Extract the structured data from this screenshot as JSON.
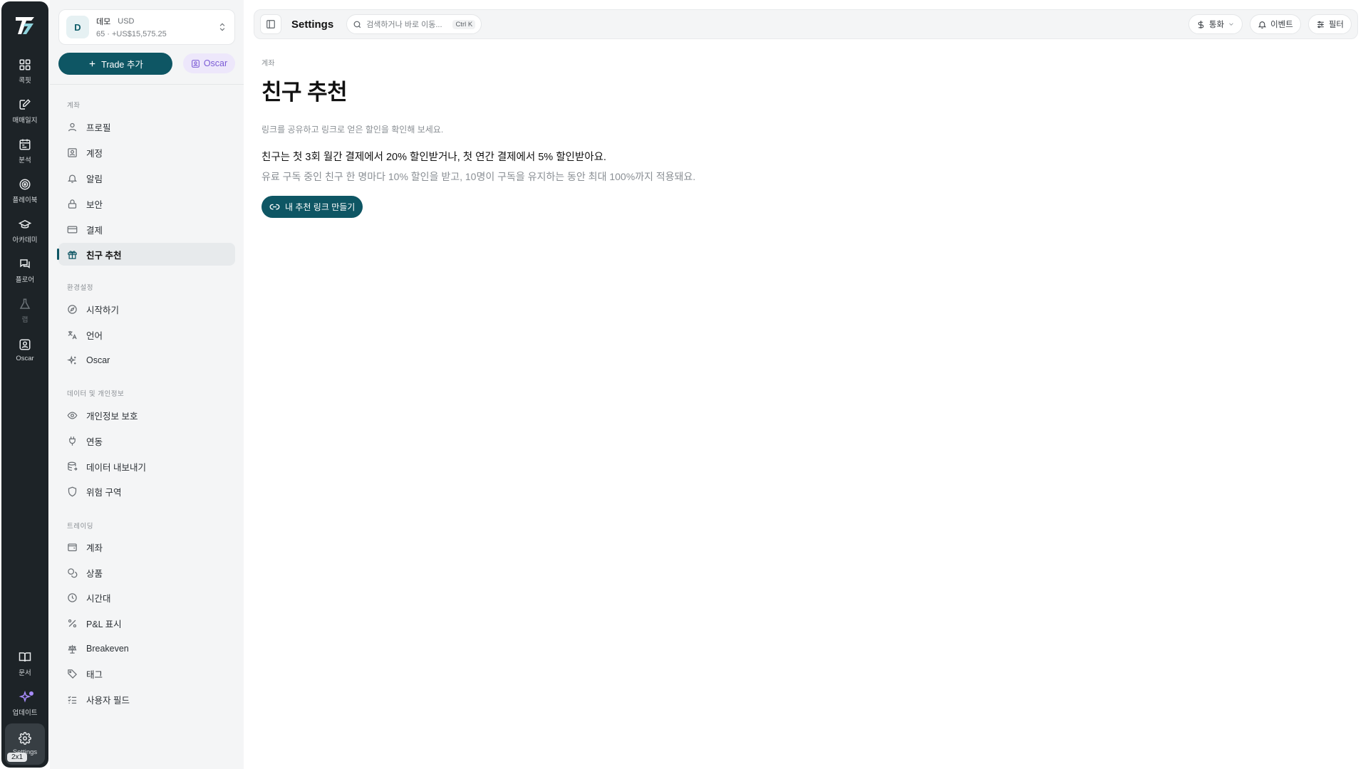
{
  "rail": {
    "items": [
      {
        "label": "콕핏",
        "icon": "dashboard-icon"
      },
      {
        "label": "매매일지",
        "icon": "journal-icon"
      },
      {
        "label": "분석",
        "icon": "calendar-icon"
      },
      {
        "label": "플레이북",
        "icon": "target-icon"
      },
      {
        "label": "아카데미",
        "icon": "graduation-cap-icon"
      },
      {
        "label": "플로어",
        "icon": "chat-icon"
      },
      {
        "label": "랩",
        "icon": "flask-icon"
      },
      {
        "label": "Oscar",
        "icon": "oscar-icon"
      }
    ],
    "bottom": [
      {
        "label": "문서",
        "icon": "book-icon"
      },
      {
        "label": "업데이트",
        "icon": "sparkle-icon"
      },
      {
        "label": "Settings",
        "icon": "gear-icon"
      }
    ],
    "size_badge": "2x1"
  },
  "account": {
    "initial": "D",
    "name": "데모",
    "currency": "USD",
    "summary": "65 · +US$15,575.25"
  },
  "actions": {
    "add_trade": "Trade 추가",
    "oscar": "Oscar"
  },
  "sidebar": {
    "sections": [
      {
        "title": "계좌",
        "items": [
          {
            "label": "프로필",
            "icon": "user-icon"
          },
          {
            "label": "계정",
            "icon": "id-card-icon"
          },
          {
            "label": "알림",
            "icon": "bell-icon"
          },
          {
            "label": "보안",
            "icon": "lock-icon"
          },
          {
            "label": "결제",
            "icon": "credit-card-icon"
          },
          {
            "label": "친구 추천",
            "icon": "gift-icon",
            "active": true
          }
        ]
      },
      {
        "title": "환경설정",
        "items": [
          {
            "label": "시작하기",
            "icon": "compass-icon"
          },
          {
            "label": "언어",
            "icon": "translate-icon"
          },
          {
            "label": "Oscar",
            "icon": "sparkles-icon"
          }
        ]
      },
      {
        "title": "데이터 및 개인정보",
        "items": [
          {
            "label": "개인정보 보호",
            "icon": "eye-icon"
          },
          {
            "label": "연동",
            "icon": "plug-icon"
          },
          {
            "label": "데이터 내보내기",
            "icon": "database-export-icon"
          },
          {
            "label": "위험 구역",
            "icon": "shield-icon"
          }
        ]
      },
      {
        "title": "트레이딩",
        "items": [
          {
            "label": "계좌",
            "icon": "wallet-icon"
          },
          {
            "label": "상품",
            "icon": "coins-icon"
          },
          {
            "label": "시간대",
            "icon": "clock-icon"
          },
          {
            "label": "P&L 표시",
            "icon": "percent-icon"
          },
          {
            "label": "Breakeven",
            "icon": "scale-icon"
          },
          {
            "label": "태그",
            "icon": "tag-icon"
          },
          {
            "label": "사용자 필드",
            "icon": "list-checks-icon"
          }
        ]
      }
    ]
  },
  "topbar": {
    "title": "Settings",
    "search_placeholder": "검색하거나 바로 이동...",
    "search_shortcut": "Ctrl K",
    "currency_label": "통화",
    "events_label": "이벤트",
    "filter_label": "필터"
  },
  "main": {
    "breadcrumb": "계좌",
    "title": "친구 추천",
    "description": "링크를 공유하고 링크로 얻은 할인을 확인해 보세요.",
    "headline": "친구는 첫 3회 월간 결제에서 20% 할인받거나, 첫 연간 결제에서 5% 할인받아요.",
    "subline": "유료 구독 중인 친구 한 명마다 10% 할인을 받고, 10명이 구독을 유지하는 동안 최대 100%까지 적용돼요.",
    "cta": "내 추천 링크 만들기"
  }
}
